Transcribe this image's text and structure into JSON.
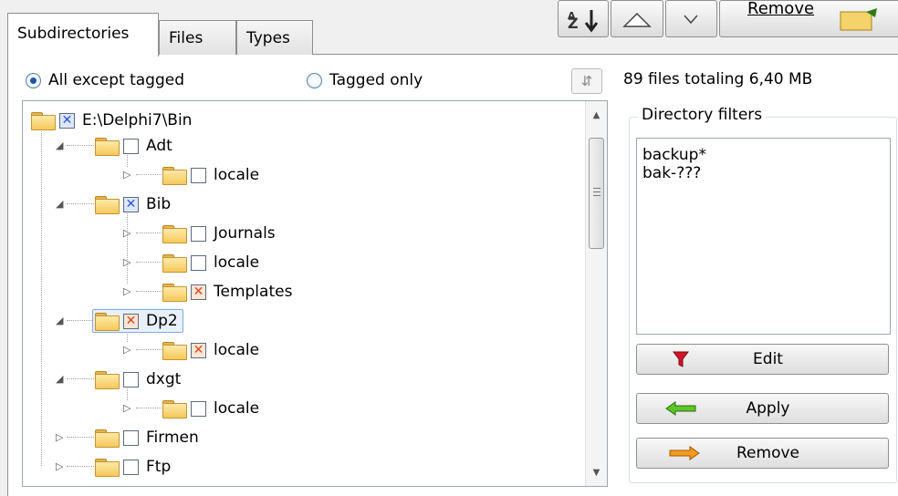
{
  "tabs": [
    {
      "label": "Subdirectories",
      "active": true
    },
    {
      "label": "Files",
      "active": false
    },
    {
      "label": "Types",
      "active": false
    }
  ],
  "toolbar": {
    "sort_icon": "sort-za-icon",
    "up_icon": "triangle-up-icon",
    "down_icon": "chevron-down-icon",
    "remove_label": "Remove"
  },
  "filter_mode": {
    "option1": "All except tagged",
    "option2": "Tagged only",
    "selected": "All except tagged"
  },
  "summary": "89 files totaling 6,40 MB",
  "tree": {
    "root": "E:\\Delphi7\\Bin",
    "items": [
      {
        "label": "Adt",
        "level": 1,
        "expanded": true,
        "check": "none"
      },
      {
        "label": "locale",
        "level": 2,
        "expanded": false,
        "check": "none"
      },
      {
        "label": "Bib",
        "level": 1,
        "expanded": true,
        "check": "blue"
      },
      {
        "label": "Journals",
        "level": 2,
        "expanded": false,
        "check": "none"
      },
      {
        "label": "locale",
        "level": 2,
        "expanded": false,
        "check": "none"
      },
      {
        "label": "Templates",
        "level": 2,
        "expanded": false,
        "check": "orange"
      },
      {
        "label": "Dp2",
        "level": 1,
        "expanded": true,
        "check": "orange",
        "selected": true
      },
      {
        "label": "locale",
        "level": 2,
        "expanded": false,
        "check": "orange"
      },
      {
        "label": "dxgt",
        "level": 1,
        "expanded": true,
        "check": "none"
      },
      {
        "label": "locale",
        "level": 2,
        "expanded": false,
        "check": "none"
      },
      {
        "label": "Firmen",
        "level": 1,
        "expanded": false,
        "check": "none"
      },
      {
        "label": "Ftp",
        "level": 1,
        "expanded": false,
        "check": "none"
      }
    ]
  },
  "directory_filters": {
    "title": "Directory filters",
    "lines": [
      "backup*",
      "bak-???"
    ]
  },
  "buttons": {
    "edit": "Edit",
    "apply": "Apply",
    "remove": "Remove"
  },
  "colors": {
    "check_blue": "#2c55d6",
    "check_orange": "#e04a10",
    "selection": "#e8f1fb"
  }
}
